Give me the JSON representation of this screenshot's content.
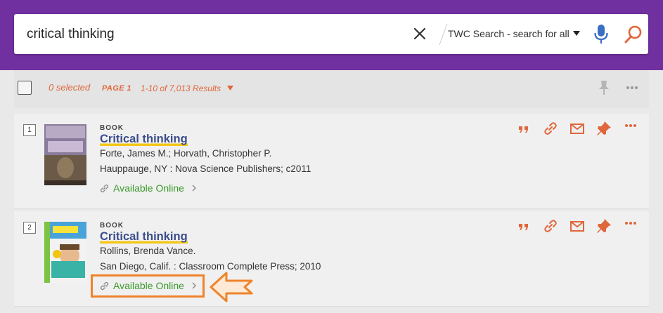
{
  "search": {
    "query": "critical thinking",
    "scope_label": "TWC Search - search for all"
  },
  "toolbar": {
    "selected_label": "0 selected",
    "page_label": "PAGE 1",
    "results_label": "1-10 of 7,013 Results"
  },
  "records": [
    {
      "number": "1",
      "type": "BOOK",
      "title": "Critical thinking",
      "author": "Forte, James M.; Horvath, Christopher P.",
      "publication": "Hauppauge, NY : Nova Science Publishers; c2011",
      "availability": "Available Online"
    },
    {
      "number": "2",
      "type": "BOOK",
      "title": "Critical thinking",
      "author": "Rollins, Brenda Vance.",
      "publication": "San Diego, Calif. : Classroom Complete Press; 2010",
      "availability": "Available Online"
    }
  ],
  "colors": {
    "header_bg": "#7030a0",
    "accent": "#e0663b",
    "available": "#3a9a2a",
    "title": "#3b4d8c",
    "callout": "#f0832a"
  }
}
